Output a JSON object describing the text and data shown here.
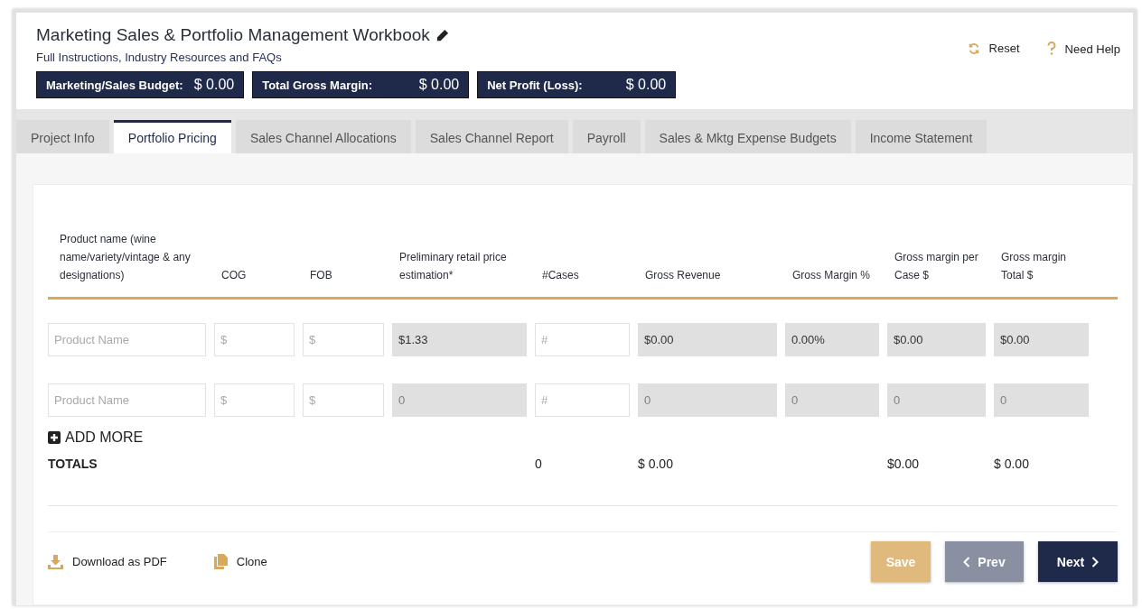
{
  "header": {
    "title": "Marketing Sales & Portfolio Management Workbook",
    "link": "Full Instructions, Industry Resources and FAQs",
    "actions": [
      {
        "kind": "reset",
        "label": "Reset"
      },
      {
        "kind": "help",
        "label": "Need Help"
      }
    ],
    "summaries": [
      {
        "label": "Marketing/Sales Budget:",
        "value": "$ 0.00"
      },
      {
        "label": "Total Gross Margin:",
        "value": "$ 0.00"
      },
      {
        "label": "Net Profit (Loss):",
        "value": "$ 0.00"
      }
    ]
  },
  "tabs": [
    {
      "label": "Project Info",
      "selected": false
    },
    {
      "label": "Portfolio Pricing",
      "selected": true
    },
    {
      "label": "Sales Channel Allocations",
      "selected": false
    },
    {
      "label": "Sales Channel Report",
      "selected": false
    },
    {
      "label": "Payroll",
      "selected": false
    },
    {
      "label": "Sales & Mktg Expense Budgets",
      "selected": false
    },
    {
      "label": "Income Statement",
      "selected": false
    }
  ],
  "table": {
    "columns": [
      "Product name (wine name/variety/vintage & any designations)",
      "COG",
      "FOB",
      "Preliminary retail price estimation*",
      "#Cases",
      "Gross Revenue",
      "Gross Margin %",
      "Gross margin per Case $",
      "Gross margin Total $"
    ],
    "rows": [
      [
        {
          "kind": "input",
          "placeholder": "Product Name"
        },
        {
          "kind": "input",
          "placeholder": "$"
        },
        {
          "kind": "input",
          "placeholder": "$"
        },
        {
          "kind": "computed",
          "value": "$1.33"
        },
        {
          "kind": "input",
          "placeholder": "#"
        },
        {
          "kind": "computed",
          "value": "$0.00"
        },
        {
          "kind": "computed",
          "value": "0.00%"
        },
        {
          "kind": "computed",
          "value": "$0.00"
        },
        {
          "kind": "computed",
          "value": "$0.00"
        }
      ],
      [
        {
          "kind": "input",
          "placeholder": "Product Name"
        },
        {
          "kind": "input",
          "placeholder": "$"
        },
        {
          "kind": "input",
          "placeholder": "$"
        },
        {
          "kind": "computed",
          "placeholder": "0"
        },
        {
          "kind": "input",
          "placeholder": "#"
        },
        {
          "kind": "computed",
          "placeholder": "0"
        },
        {
          "kind": "computed",
          "placeholder": "0"
        },
        {
          "kind": "computed",
          "placeholder": "0"
        },
        {
          "kind": "computed",
          "placeholder": "0"
        }
      ]
    ],
    "add_more": "ADD MORE",
    "totals": {
      "label": "TOTALS",
      "cases": "0",
      "gross_revenue": "$ 0.00",
      "margin_per_case": "$0.00",
      "margin_total": "$ 0.00"
    }
  },
  "footer": {
    "links": [
      {
        "kind": "download",
        "label": "Download as PDF"
      },
      {
        "kind": "clone",
        "label": "Clone"
      }
    ],
    "buttons": [
      {
        "kind": "save",
        "label": "Save"
      },
      {
        "kind": "prev",
        "label": "Prev"
      },
      {
        "kind": "next",
        "label": "Next"
      }
    ]
  }
}
